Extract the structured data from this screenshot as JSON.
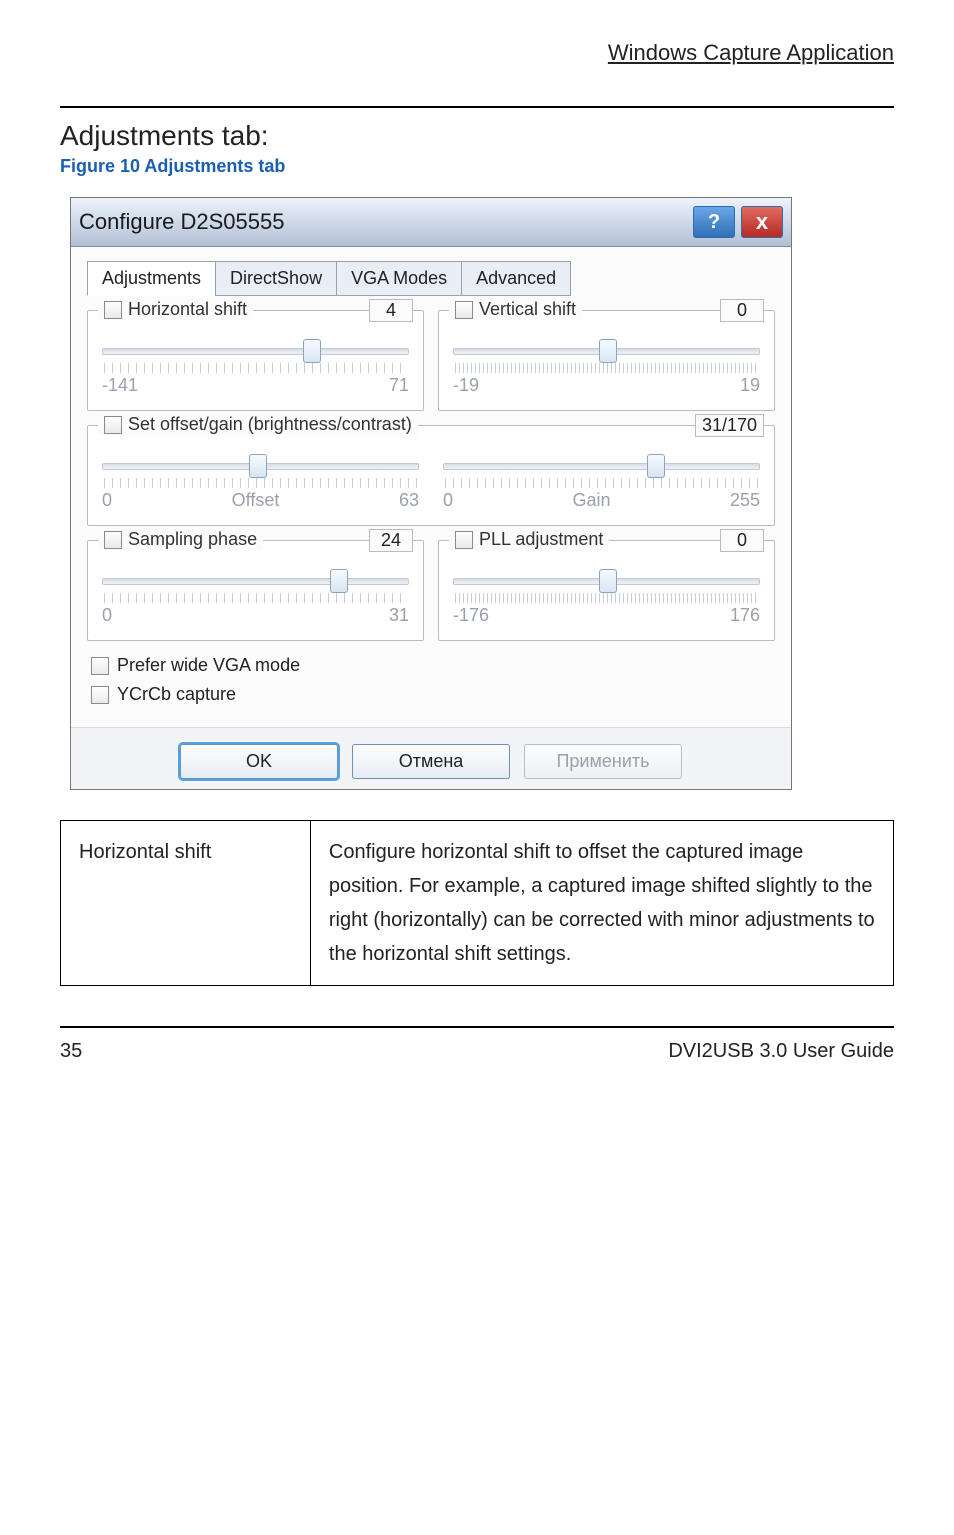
{
  "header": {
    "section": "Windows Capture Application"
  },
  "headings": {
    "h2": "Adjustments tab:",
    "figcap": "Figure 10 Adjustments tab"
  },
  "dialog": {
    "title": "Configure D2S05555",
    "help_glyph": "?",
    "close_glyph": "x",
    "tabs": [
      "Adjustments",
      "DirectShow",
      "VGA Modes",
      "Advanced"
    ],
    "active_tab_index": 0,
    "groups": {
      "hshift": {
        "label": "Horizontal shift",
        "value": "4",
        "min": "-141",
        "max": "71",
        "thumb_pct": 68,
        "ticks": "coarse"
      },
      "vshift": {
        "label": "Vertical shift",
        "value": "0",
        "min": "-19",
        "max": "19",
        "thumb_pct": 50,
        "ticks": "fine"
      },
      "offgain": {
        "label": "Set offset/gain (brightness/contrast)",
        "value": "31/170",
        "off_min": "0",
        "off_lbl": "Offset",
        "off_max": "63",
        "off_thumb_pct": 49,
        "gain_min": "0",
        "gain_lbl": "Gain",
        "gain_max": "255",
        "gain_thumb_pct": 67
      },
      "sphase": {
        "label": "Sampling phase",
        "value": "24",
        "min": "0",
        "max": "31",
        "thumb_pct": 77,
        "ticks": "coarse"
      },
      "pll": {
        "label": "PLL adjustment",
        "value": "0",
        "min": "-176",
        "max": "176",
        "thumb_pct": 50,
        "ticks": "fine"
      }
    },
    "checks": {
      "wide": "Prefer wide VGA mode",
      "ycrcb": "YCrCb capture"
    },
    "buttons": {
      "ok": "OK",
      "cancel": "Отмена",
      "apply": "Применить"
    }
  },
  "table": {
    "rows": [
      {
        "name": "Horizontal shift",
        "desc": "Configure horizontal shift to offset the captured image position. For example, a captured image shifted slightly to the right (horizontally) can be corrected with minor adjustments to the horizontal shift settings."
      }
    ]
  },
  "footer": {
    "page": "35",
    "title": "DVI2USB 3.0  User Guide"
  }
}
